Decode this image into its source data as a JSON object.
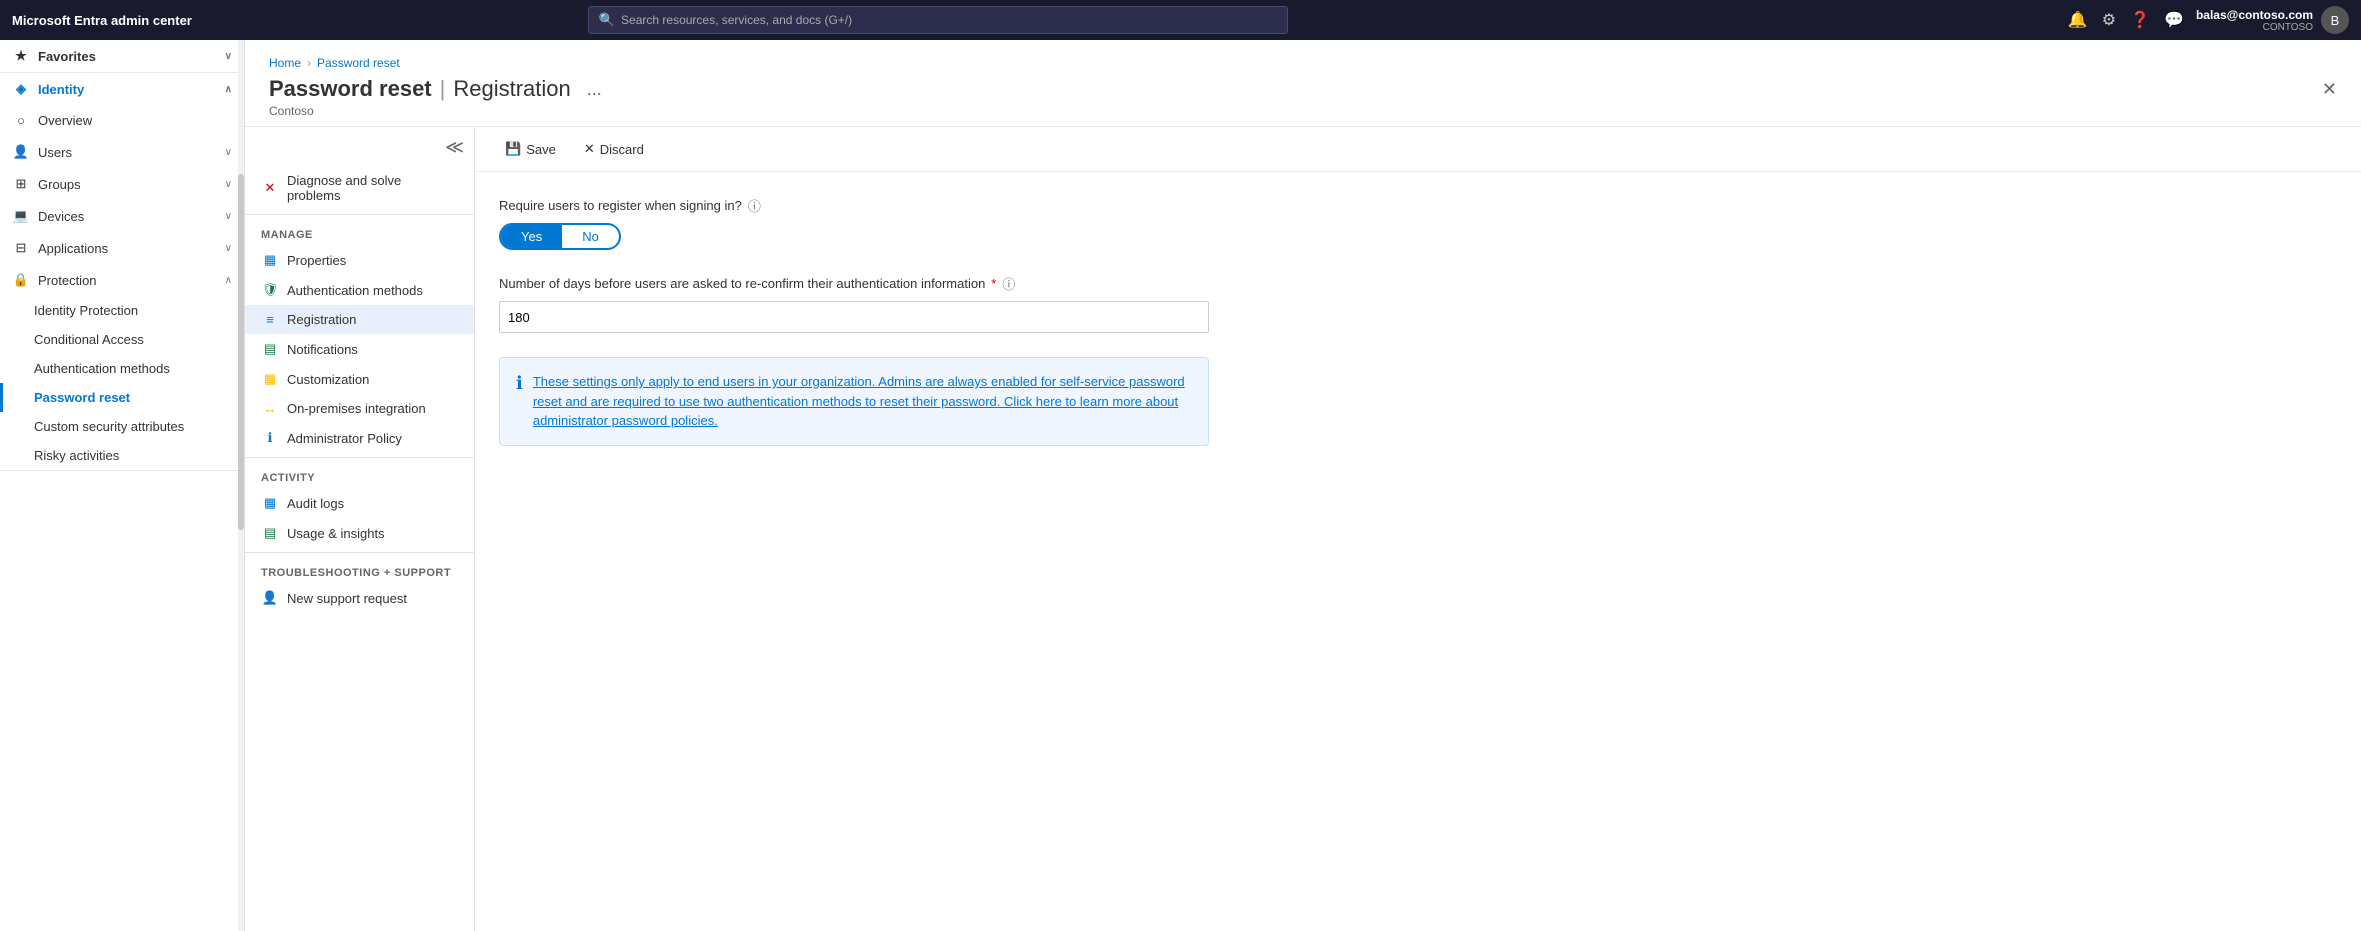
{
  "topNav": {
    "appTitle": "Microsoft Entra admin center",
    "searchPlaceholder": "Search resources, services, and docs (G+/)",
    "user": {
      "name": "balas@contoso.com",
      "org": "CONTOSO"
    }
  },
  "sidebar": {
    "favorites": {
      "label": "Favorites",
      "icon": "★"
    },
    "identity": {
      "label": "Identity",
      "icon": "◈"
    },
    "items": [
      {
        "label": "Overview",
        "icon": "○",
        "hasChevron": false
      },
      {
        "label": "Users",
        "icon": "👤",
        "hasChevron": true
      },
      {
        "label": "Groups",
        "icon": "⊞",
        "hasChevron": true
      },
      {
        "label": "Devices",
        "icon": "💻",
        "hasChevron": true
      },
      {
        "label": "Applications",
        "icon": "⊟",
        "hasChevron": true
      },
      {
        "label": "Protection",
        "icon": "🔒",
        "hasChevron": true
      }
    ],
    "protectionSubItems": [
      {
        "label": "Identity Protection",
        "active": false
      },
      {
        "label": "Conditional Access",
        "active": false
      },
      {
        "label": "Authentication methods",
        "active": false
      },
      {
        "label": "Password reset",
        "active": true
      },
      {
        "label": "Custom security attributes",
        "active": false
      },
      {
        "label": "Risky activities",
        "active": false
      }
    ]
  },
  "secondSidebar": {
    "collapseTitle": "Collapse sidebar",
    "diagnose": {
      "label": "Diagnose and solve problems",
      "icon": "✕"
    },
    "manage": {
      "sectionLabel": "Manage",
      "items": [
        {
          "label": "Properties",
          "icon": "▦",
          "active": false
        },
        {
          "label": "Authentication methods",
          "icon": "🛡",
          "active": false
        },
        {
          "label": "Registration",
          "icon": "≡",
          "active": true
        },
        {
          "label": "Notifications",
          "icon": "▤",
          "active": false
        },
        {
          "label": "Customization",
          "icon": "▦",
          "active": false
        },
        {
          "label": "On-premises integration",
          "icon": "↔",
          "active": false
        },
        {
          "label": "Administrator Policy",
          "icon": "ℹ",
          "active": false
        }
      ]
    },
    "activity": {
      "sectionLabel": "Activity",
      "items": [
        {
          "label": "Audit logs",
          "icon": "▦"
        },
        {
          "label": "Usage & insights",
          "icon": "▤"
        }
      ]
    },
    "troubleshooting": {
      "sectionLabel": "Troubleshooting + Support",
      "items": [
        {
          "label": "New support request",
          "icon": "👤"
        }
      ]
    }
  },
  "pageHeader": {
    "breadcrumb": {
      "home": "Home",
      "section": "Password reset"
    },
    "title": "Password reset",
    "separator": "|",
    "subtitle": "Registration",
    "org": "Contoso",
    "ellipsisLabel": "...",
    "closeLabel": "✕"
  },
  "toolbar": {
    "saveLabel": "Save",
    "discardLabel": "Discard",
    "saveIcon": "💾",
    "discardIcon": "✕"
  },
  "content": {
    "requireRegisterQuestion": "Require users to register when signing in?",
    "requireRegisterInfoIcon": "ℹ",
    "toggleYes": "Yes",
    "toggleNo": "No",
    "daysLabel": "Number of days before users are asked to re-confirm their authentication information",
    "daysRequired": "*",
    "daysInfoIcon": "ℹ",
    "daysValue": "180",
    "infoText": "These settings only apply to end users in your organization. Admins are always enabled for self-service password reset and are required to use two authentication methods to reset their password. Click here to learn more about administrator password policies."
  }
}
